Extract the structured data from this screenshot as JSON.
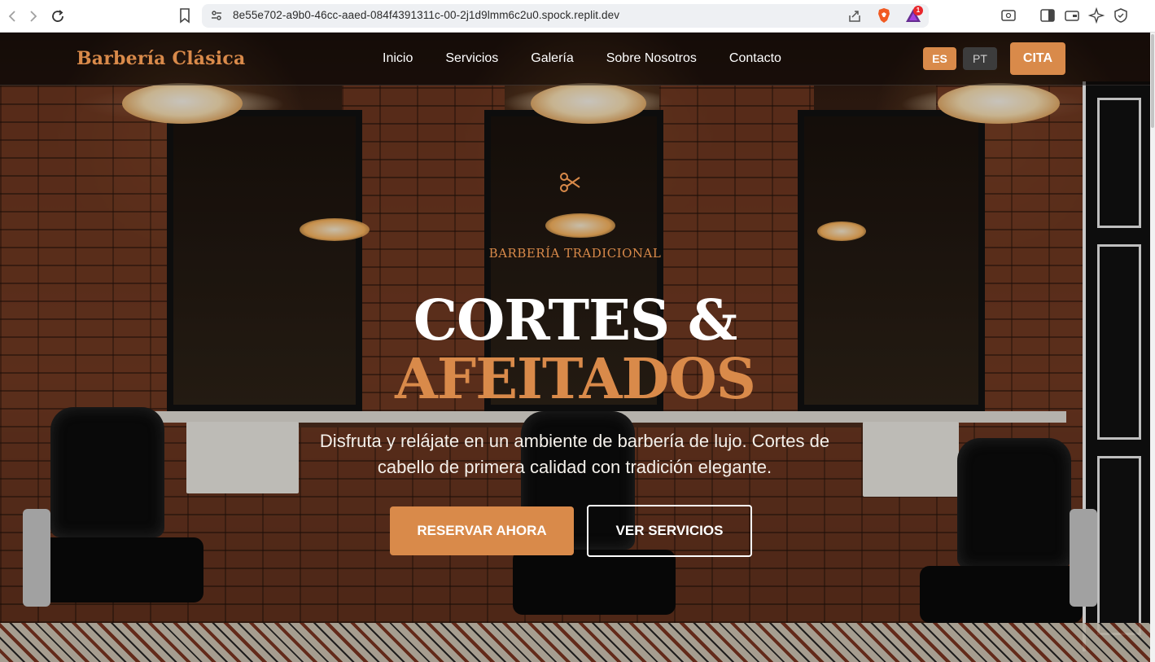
{
  "browser": {
    "url": "8e55e702-a9b0-46cc-aaed-084f4391311c-00-2j1d9lmm6c2u0.spock.replit.dev",
    "rewards_count": "1"
  },
  "nav": {
    "logo": "Barbería Clásica",
    "links": [
      "Inicio",
      "Servicios",
      "Galería",
      "Sobre Nosotros",
      "Contacto"
    ],
    "lang_es": "ES",
    "lang_pt": "PT",
    "cta": "CITA"
  },
  "hero": {
    "tagline": "BARBERÍA TRADICIONAL",
    "headline_line1": "CORTES &",
    "headline_line2": "AFEITADOS",
    "subtext": "Disfruta y relájate en un ambiente de barbería de lujo. Cortes de cabello de primera calidad con tradición elegante.",
    "primary_button": "RESERVAR AHORA",
    "secondary_button": "VER SERVICIOS"
  },
  "colors": {
    "accent": "#d98a4a",
    "nav_bg": "#0c0806",
    "text_light": "#ffffff"
  },
  "icons": [
    "back-icon",
    "forward-icon",
    "reload-icon",
    "bookmark-icon",
    "site-info-icon",
    "share-icon",
    "brave-shields-icon",
    "brave-rewards-icon",
    "reader-mode-icon",
    "sidebar-icon",
    "wallet-icon",
    "leo-ai-icon",
    "vpn-icon",
    "scissors-icon"
  ]
}
